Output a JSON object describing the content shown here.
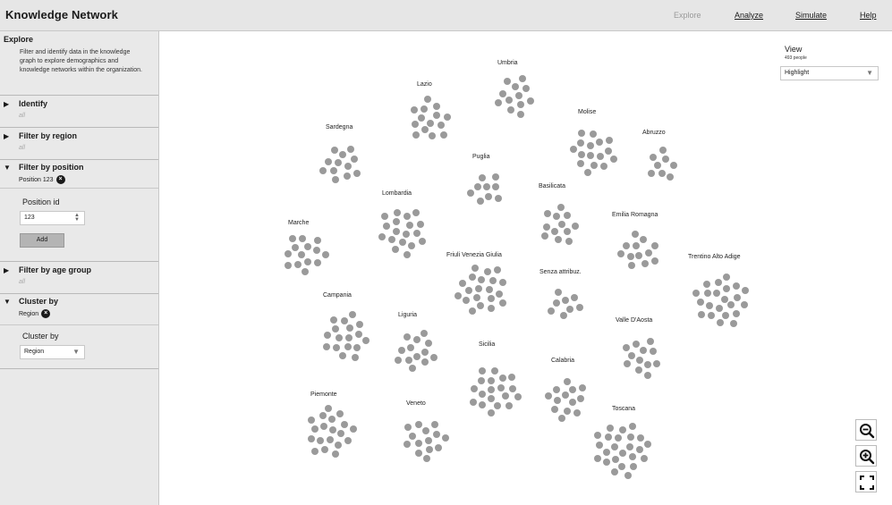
{
  "app": {
    "title": "Knowledge Network"
  },
  "nav": [
    {
      "label": "Explore",
      "current": true
    },
    {
      "label": "Analyze",
      "current": false
    },
    {
      "label": "Simulate",
      "current": false
    },
    {
      "label": "Help",
      "current": false
    }
  ],
  "sidebar": {
    "title": "Explore",
    "description": "Filter and identify data in the knowledge graph to explore demographics and knowledge networks within the organization.",
    "sections": {
      "identify": {
        "title": "Identify",
        "value": "all",
        "expanded": false
      },
      "region": {
        "title": "Filter by region",
        "value": "all",
        "expanded": false
      },
      "position": {
        "title": "Filter by position",
        "chip": "Position 123",
        "expanded": true,
        "field_label": "Position id",
        "field_value": "123",
        "add_label": "Add"
      },
      "age": {
        "title": "Filter by age group",
        "value": "all",
        "expanded": false
      },
      "cluster": {
        "title": "Cluster by",
        "chip": "Region",
        "expanded": true,
        "field_label": "Cluster by",
        "select_value": "Region"
      }
    }
  },
  "view": {
    "title": "View",
    "count": "493 people",
    "mode": "Highlight"
  },
  "icons": {
    "zoom_out": "zoom-out-icon",
    "zoom_in": "zoom-in-icon",
    "fullscreen": "fullscreen-icon",
    "remove_chip": "close-circle-icon",
    "expand": "triangle-right-icon",
    "collapse": "triangle-down-icon"
  },
  "colors": {
    "node": "#9a9a9a",
    "sidebar": "#e9e9e9",
    "topbar": "#e6e6e6"
  },
  "clusters": [
    {
      "label": "Umbria",
      "count": 12
    },
    {
      "label": "Lazio",
      "count": 14
    },
    {
      "label": "Molise",
      "count": 16
    },
    {
      "label": "Abruzzo",
      "count": 8
    },
    {
      "label": "Sardegna",
      "count": 12
    },
    {
      "label": "Puglia",
      "count": 9
    },
    {
      "label": "Basilicata",
      "count": 12
    },
    {
      "label": "Lombardia",
      "count": 18
    },
    {
      "label": "Emilia Romagna",
      "count": 12
    },
    {
      "label": "Marche",
      "count": 14
    },
    {
      "label": "Friuli Venezia Giulia",
      "count": 20
    },
    {
      "label": "Senza attribuz.",
      "count": 8
    },
    {
      "label": "Trentino Alto Adige",
      "count": 22
    },
    {
      "label": "Campania",
      "count": 17
    },
    {
      "label": "Liguria",
      "count": 13
    },
    {
      "label": "Valle D'Aosta",
      "count": 12
    },
    {
      "label": "Sicilia",
      "count": 19
    },
    {
      "label": "Calabria",
      "count": 13
    },
    {
      "label": "Piemonte",
      "count": 19
    },
    {
      "label": "Veneto",
      "count": 14
    },
    {
      "label": "Toscana",
      "count": 24
    }
  ]
}
